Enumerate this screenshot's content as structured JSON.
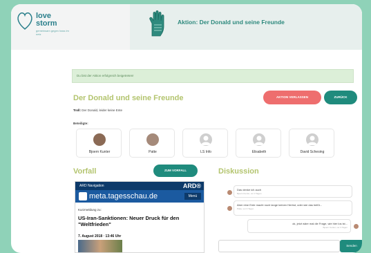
{
  "brand": {
    "logo_text_1": "love",
    "logo_text_2": "storm",
    "logo_sub": "gemeinsam gegen hass im netz"
  },
  "header": {
    "title": "Aktion: Der Donald und seine Freunde"
  },
  "alert": {
    "text": "Du bist der Aktion erfolgreich beigetreten!"
  },
  "action": {
    "title": "Der Donald und seine Freunde",
    "troll_label": "Troll:",
    "troll_value": "Der Donald, leider keine Ente",
    "participants_label": "Beteiligte:",
    "leave_button": "AKTION VERLASSEN",
    "back_button": "ZURÜCK"
  },
  "participants": [
    {
      "name": "Bjoern Kunter",
      "avatar": "photo"
    },
    {
      "name": "Patte",
      "avatar": "photo"
    },
    {
      "name": "LS Info",
      "avatar": "placeholder"
    },
    {
      "name": "Elisabeth",
      "avatar": "placeholder"
    },
    {
      "name": "David Schesing",
      "avatar": "placeholder"
    }
  ],
  "incident": {
    "heading": "Vorfall",
    "button": "ZUM VORFALL",
    "nav_label": "ARD Navigation",
    "ard_logo": "ARD®",
    "site": "meta.tagesschau.de",
    "menu_label": "Menü",
    "kicker": "Kurzmeldung zu:",
    "headline": "US-Iran-Sanktionen: Neuer Druck für den \"Weltfrieden\"",
    "date": "7. August 2018 · 13:46 Uhr"
  },
  "discussion": {
    "heading": "Diskussion",
    "messages": [
      {
        "text": "Das denke ich auch",
        "meta": "Bjoern Kunter, vor 3 Tagen"
      },
      {
        "text": "Aber eine Ente macht noch lange keinen Herbst, oder wie das heißt...",
        "meta": "Patte, vor 3 Tagen"
      },
      {
        "text": "ok, jetzt wäre mal die Frage, wie hier los ist...",
        "meta": "Bjoern Kunter, vor 3 Tagen"
      }
    ],
    "send_button": "Senden"
  },
  "colors": {
    "accent_green": "#1f8b7d",
    "heading_olive": "#b3c46e",
    "danger_red": "#ee6e6e",
    "background_mint": "#8fd2b8"
  }
}
